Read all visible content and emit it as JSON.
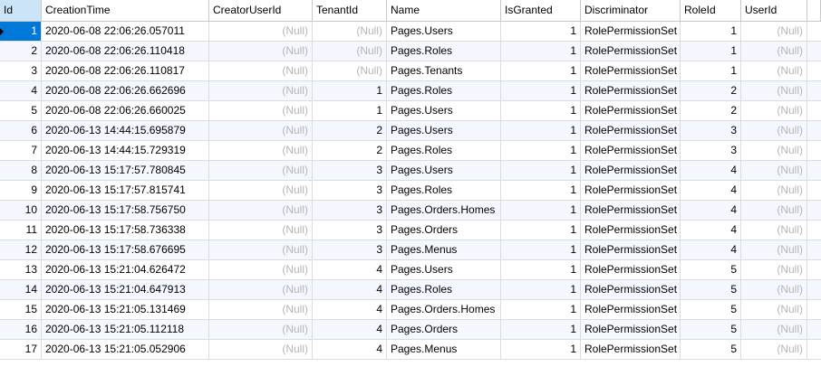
{
  "columns": [
    "Id",
    "CreationTime",
    "CreatorUserId",
    "TenantId",
    "Name",
    "IsGranted",
    "Discriminator",
    "RoleId",
    "UserId"
  ],
  "rows": [
    {
      "id": "1",
      "time": "2020-06-08 22:06:26.057011",
      "creator": "(Null)",
      "tenant": "(Null)",
      "name": "Pages.Users",
      "granted": "1",
      "disc": "RolePermissionSet",
      "role": "1",
      "user": "(Null)"
    },
    {
      "id": "2",
      "time": "2020-06-08 22:06:26.110418",
      "creator": "(Null)",
      "tenant": "(Null)",
      "name": "Pages.Roles",
      "granted": "1",
      "disc": "RolePermissionSet",
      "role": "1",
      "user": "(Null)"
    },
    {
      "id": "3",
      "time": "2020-06-08 22:06:26.110817",
      "creator": "(Null)",
      "tenant": "(Null)",
      "name": "Pages.Tenants",
      "granted": "1",
      "disc": "RolePermissionSet",
      "role": "1",
      "user": "(Null)"
    },
    {
      "id": "4",
      "time": "2020-06-08 22:06:26.662696",
      "creator": "(Null)",
      "tenant": "1",
      "name": "Pages.Roles",
      "granted": "1",
      "disc": "RolePermissionSet",
      "role": "2",
      "user": "(Null)"
    },
    {
      "id": "5",
      "time": "2020-06-08 22:06:26.660025",
      "creator": "(Null)",
      "tenant": "1",
      "name": "Pages.Users",
      "granted": "1",
      "disc": "RolePermissionSet",
      "role": "2",
      "user": "(Null)"
    },
    {
      "id": "6",
      "time": "2020-06-13 14:44:15.695879",
      "creator": "(Null)",
      "tenant": "2",
      "name": "Pages.Users",
      "granted": "1",
      "disc": "RolePermissionSet",
      "role": "3",
      "user": "(Null)"
    },
    {
      "id": "7",
      "time": "2020-06-13 14:44:15.729319",
      "creator": "(Null)",
      "tenant": "2",
      "name": "Pages.Roles",
      "granted": "1",
      "disc": "RolePermissionSet",
      "role": "3",
      "user": "(Null)"
    },
    {
      "id": "8",
      "time": "2020-06-13 15:17:57.780845",
      "creator": "(Null)",
      "tenant": "3",
      "name": "Pages.Users",
      "granted": "1",
      "disc": "RolePermissionSet",
      "role": "4",
      "user": "(Null)"
    },
    {
      "id": "9",
      "time": "2020-06-13 15:17:57.815741",
      "creator": "(Null)",
      "tenant": "3",
      "name": "Pages.Roles",
      "granted": "1",
      "disc": "RolePermissionSet",
      "role": "4",
      "user": "(Null)"
    },
    {
      "id": "10",
      "time": "2020-06-13 15:17:58.756750",
      "creator": "(Null)",
      "tenant": "3",
      "name": "Pages.Orders.Homes",
      "granted": "1",
      "disc": "RolePermissionSet",
      "role": "4",
      "user": "(Null)"
    },
    {
      "id": "11",
      "time": "2020-06-13 15:17:58.736338",
      "creator": "(Null)",
      "tenant": "3",
      "name": "Pages.Orders",
      "granted": "1",
      "disc": "RolePermissionSet",
      "role": "4",
      "user": "(Null)"
    },
    {
      "id": "12",
      "time": "2020-06-13 15:17:58.676695",
      "creator": "(Null)",
      "tenant": "3",
      "name": "Pages.Menus",
      "granted": "1",
      "disc": "RolePermissionSet",
      "role": "4",
      "user": "(Null)"
    },
    {
      "id": "13",
      "time": "2020-06-13 15:21:04.626472",
      "creator": "(Null)",
      "tenant": "4",
      "name": "Pages.Users",
      "granted": "1",
      "disc": "RolePermissionSet",
      "role": "5",
      "user": "(Null)"
    },
    {
      "id": "14",
      "time": "2020-06-13 15:21:04.647913",
      "creator": "(Null)",
      "tenant": "4",
      "name": "Pages.Roles",
      "granted": "1",
      "disc": "RolePermissionSet",
      "role": "5",
      "user": "(Null)"
    },
    {
      "id": "15",
      "time": "2020-06-13 15:21:05.131469",
      "creator": "(Null)",
      "tenant": "4",
      "name": "Pages.Orders.Homes",
      "granted": "1",
      "disc": "RolePermissionSet",
      "role": "5",
      "user": "(Null)"
    },
    {
      "id": "16",
      "time": "2020-06-13 15:21:05.112118",
      "creator": "(Null)",
      "tenant": "4",
      "name": "Pages.Orders",
      "granted": "1",
      "disc": "RolePermissionSet",
      "role": "5",
      "user": "(Null)"
    },
    {
      "id": "17",
      "time": "2020-06-13 15:21:05.052906",
      "creator": "(Null)",
      "tenant": "4",
      "name": "Pages.Menus",
      "granted": "1",
      "disc": "RolePermissionSet",
      "role": "5",
      "user": "(Null)"
    }
  ],
  "selected_row": 0,
  "colors": {
    "selection": "#0078d7",
    "null_text": "#b5b5b5",
    "alt_row": "#f4f8fe",
    "grid_line": "#dcdcdc"
  }
}
